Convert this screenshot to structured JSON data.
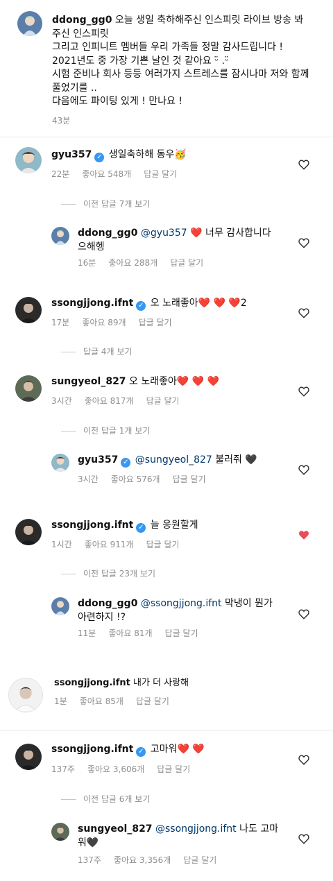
{
  "post": {
    "user": "ddong_gg0",
    "lines": [
      "오늘 생일 축하해주신 인스피릿 라이브 방송 봐",
      "주신 인스피릿",
      "그리고 인피니트 멤버들 우리 가족들 정말 감사드립니다 !",
      "2021년도 중 가장 기쁜 날인 것 같아요 ᵕ̈ .ᵕ̈",
      "시험 준비나 회사 등등 여러가지 스트레스를 잠시나마 저와 함께",
      "풀었기를 ..",
      "다음에도 파이팅 있게 ! 만나요 !"
    ],
    "time": "43분"
  },
  "comments": [
    {
      "user": "gyu357",
      "verified": true,
      "text": "생일축하해 동우",
      "emoji": "🥳",
      "time": "22분",
      "likes": "좋아요 548개",
      "reply": "답글 달기",
      "view_replies": "이전 답글 7개 보기",
      "replies": [
        {
          "user": "ddong_gg0",
          "mention": "@gyu357",
          "heart": "❤️",
          "text": "너무 감사합니다",
          "text2": "으해헹",
          "time": "16분",
          "likes": "좋아요 288개",
          "reply": "답글 달기"
        }
      ]
    },
    {
      "user": "ssongjjong.ifnt",
      "verified": true,
      "text": "오 노래좋아",
      "hearts": "❤️ ❤️ ❤️",
      "tail": "2",
      "time": "17분",
      "likes": "좋아요 89개",
      "reply": "답글 달기",
      "view_replies": "답글 4개 보기"
    },
    {
      "user": "sungyeol_827",
      "verified": false,
      "text": "오 노래좋아",
      "hearts": "❤️ ❤️ ❤️",
      "time": "3시간",
      "likes": "좋아요 817개",
      "reply": "답글 달기",
      "view_replies": "이전 답글 1개 보기",
      "replies": [
        {
          "user": "gyu357",
          "verified": true,
          "mention": "@sungyeol_827",
          "text": "불러줘",
          "heart": "🖤",
          "time": "3시간",
          "likes": "좋아요 576개",
          "reply": "답글 달기"
        }
      ]
    },
    {
      "user": "ssongjjong.ifnt",
      "verified": true,
      "text": "늘 응원할게",
      "liked": true,
      "time": "1시간",
      "likes": "좋아요 911개",
      "reply": "답글 달기",
      "view_replies": "이전 답글 23개 보기",
      "replies": [
        {
          "user": "ddong_gg0",
          "mention": "@ssongjjong.ifnt",
          "text": "막냉이 뭔가",
          "text2": "아련하지 !?",
          "time": "11분",
          "likes": "좋아요 81개",
          "reply": "답글 달기"
        }
      ]
    },
    {
      "user": "ssongjjong.ifnt",
      "verified": false,
      "text": "내가 더 사랑해",
      "time": "1분",
      "likes": "좋아요 85개",
      "reply": "답글 달기"
    },
    {
      "user": "ssongjjong.ifnt",
      "verified": true,
      "text": "고마워",
      "hearts": "❤️ ❤️",
      "time": "137주",
      "likes": "좋아요 3,606개",
      "reply": "답글 달기",
      "view_replies": "이전 답글 6개 보기",
      "replies": [
        {
          "user": "sungyeol_827",
          "mention": "@ssongjjong.ifnt",
          "text": "나도 고마",
          "text2": "워",
          "heart2": "🖤",
          "time": "137주",
          "likes": "좋아요 3,356개",
          "reply": "답글 달기"
        }
      ]
    }
  ],
  "colors": {
    "mention": "#00376b",
    "meta": "#8e8e8e",
    "like_active": "#ed4956",
    "verified": "#3897f0"
  }
}
